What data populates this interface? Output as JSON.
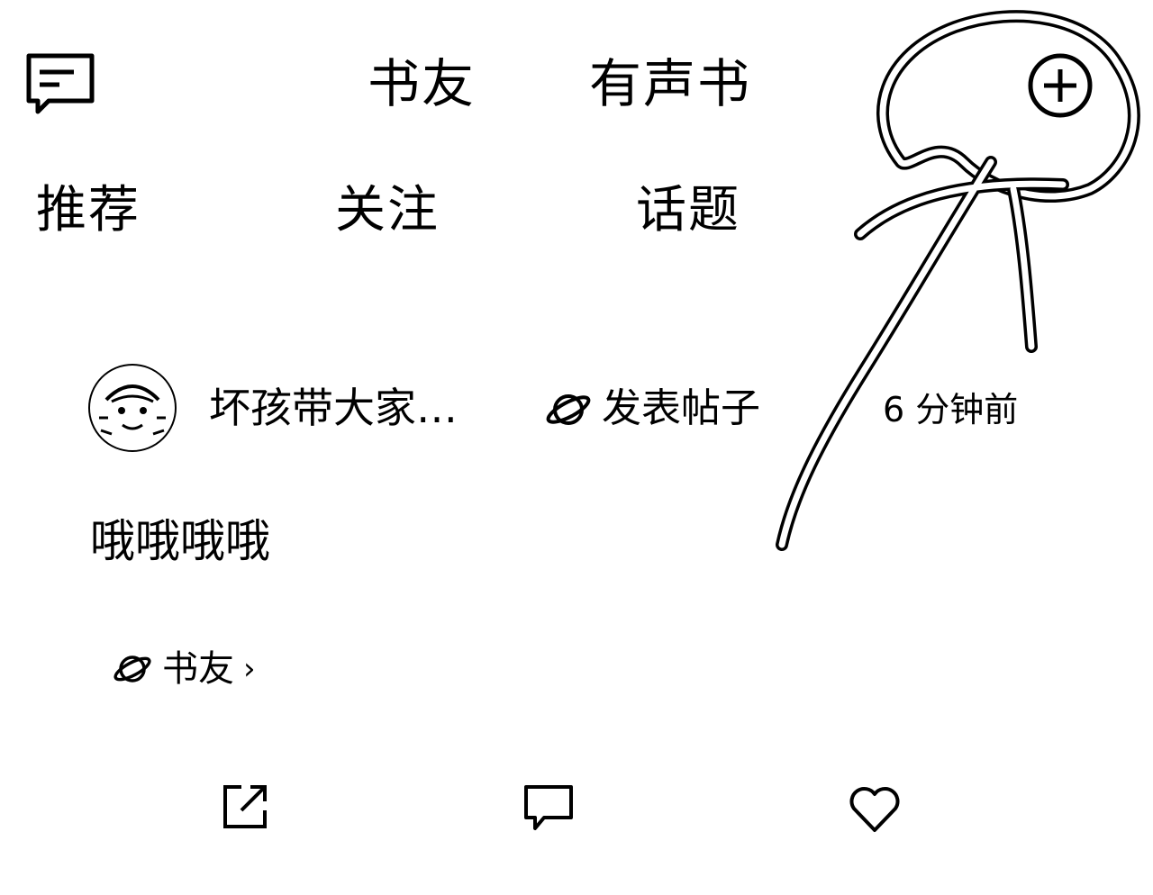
{
  "header": {
    "tabs": [
      {
        "label": "书友"
      },
      {
        "label": "有声书"
      }
    ],
    "left_icon": "message-icon",
    "right_icon": "plus-circle-icon"
  },
  "subtabs": [
    {
      "label": "推荐"
    },
    {
      "label": "关注"
    },
    {
      "label": "话题"
    },
    {
      "label": ""
    }
  ],
  "post": {
    "author": "坏孩带大家…",
    "action": "发表帖子",
    "time": "6 分钟前",
    "body": "哦哦哦哦",
    "group": "书友",
    "group_chevron": "›"
  },
  "footer_actions": [
    {
      "icon": "share-icon"
    },
    {
      "icon": "comment-icon"
    },
    {
      "icon": "heart-icon"
    }
  ]
}
